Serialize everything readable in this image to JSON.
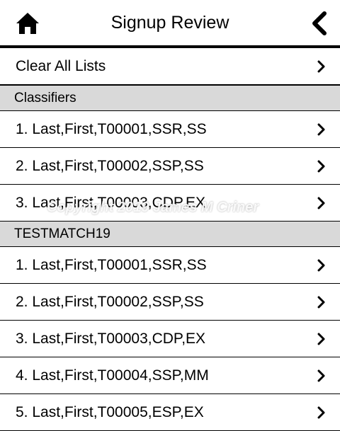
{
  "header": {
    "title": "Signup Review",
    "home_icon": "home-icon",
    "back_icon": "chevron-left-icon"
  },
  "top_row": {
    "label": "Clear All Lists"
  },
  "sections": [
    {
      "title": "Classifiers",
      "items": [
        "1. Last,First,T00001,SSR,SS",
        "2. Last,First,T00002,SSP,SS",
        "3. Last,First,T00003,CDP,EX"
      ]
    },
    {
      "title": "TESTMATCH19",
      "items": [
        "1. Last,First,T00001,SSR,SS",
        "2. Last,First,T00002,SSP,SS",
        "3. Last,First,T00003,CDP,EX",
        "4. Last,First,T00004,SSP,MM",
        "5. Last,First,T00005,ESP,EX"
      ]
    }
  ],
  "watermark": "Copyright 2019 James M Criner",
  "colors": {
    "section_bg": "#d9d9d9",
    "divider": "#000000"
  }
}
